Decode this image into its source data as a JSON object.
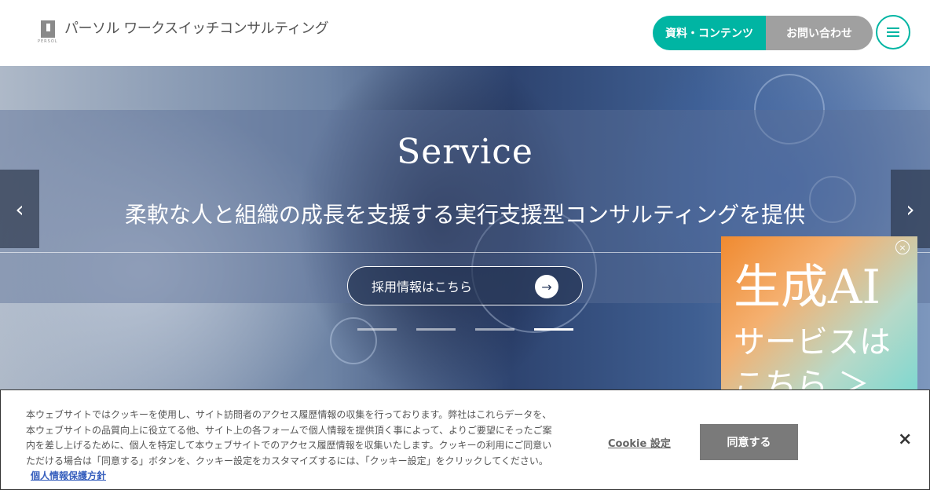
{
  "header": {
    "logo_text": "パーソル ワークスイッチコンサルティング",
    "logo_sub": "PERSOL",
    "resources_label": "資料・コンテンツ",
    "contact_label": "お問い合わせ"
  },
  "hero": {
    "title": "Service",
    "subtitle": "柔軟な人と組織の成長を支援する実行支援型コンサルティングを提供",
    "recruit_label": "採用情報はこちら",
    "prev_label": "‹",
    "next_label": "›"
  },
  "ai_banner": {
    "line1": "生成AI",
    "line2": "サービスは",
    "line3": "こちら ＞"
  },
  "cookie": {
    "text": "本ウェブサイトではクッキーを使用し、サイト訪問者のアクセス履歴情報の収集を行っております。弊社はこれらデータを、本ウェブサイトの品質向上に役立てる他、サイト上の各フォームで個人情報を提供頂く事によって、よりご要望にそったご案内を差し上げるために、個人を特定して本ウェブサイトでのアクセス履歴情報を収集いたします。クッキーの利用にご同意いただける場合は「同意する」ボタンを、クッキー設定をカスタマイズするには、「クッキー設定」をクリックしてください。",
    "policy_link": "個人情報保護方針",
    "settings_label": "Cookie 設定",
    "accept_label": "同意する",
    "close_label": "×"
  },
  "colors": {
    "accent": "#00b5a3",
    "contact_bg": "#a0a0a0",
    "accept_bg": "#7a7a7a",
    "link": "#3860be"
  },
  "icons": {
    "menu": "hamburger-menu-icon",
    "recruit_arrow": "arrow-right-icon",
    "banner_close": "circle-close-icon"
  }
}
